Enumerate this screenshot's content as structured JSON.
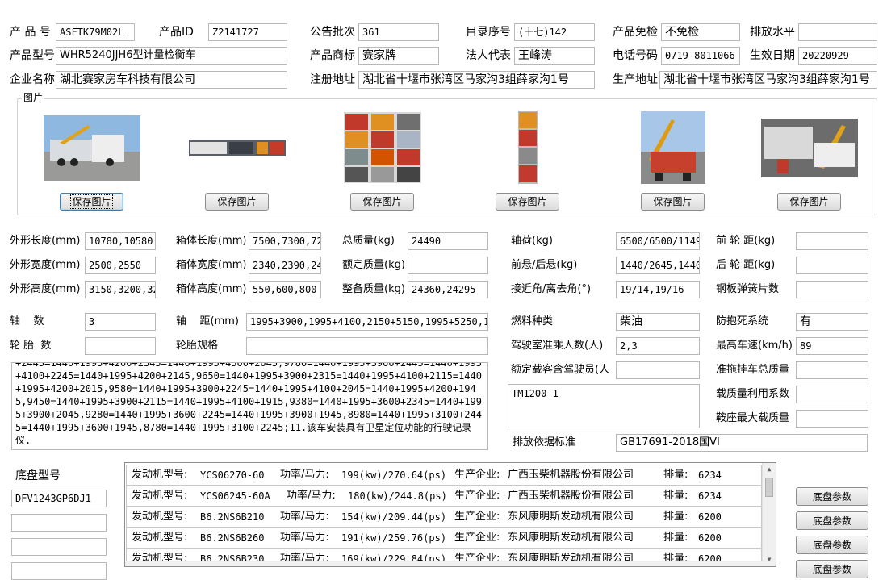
{
  "row1": {
    "product_no_label": "产 品 号",
    "product_no": "ASFTK79M02L",
    "product_id_label": "产品ID",
    "product_id": "Z2141727",
    "batch_label": "公告批次",
    "batch": "361",
    "catalog_label": "目录序号",
    "catalog": "(十七)142",
    "exempt_label": "产品免检",
    "exempt": "不免检",
    "emission_label": "排放水平",
    "emission": ""
  },
  "row2": {
    "model_label": "产品型号",
    "model": "WHR5240JJH6型计量检衡车",
    "brand_label": "产品商标",
    "brand": "赛家牌",
    "legal_label": "法人代表",
    "legal": "王峰涛",
    "phone_label": "电话号码",
    "phone": "0719-8011066",
    "effective_label": "生效日期",
    "effective": "20220929"
  },
  "row3": {
    "company_label": "企业名称",
    "company": "湖北赛家房车科技有限公司",
    "reg_addr_label": "注册地址",
    "reg_addr": "湖北省十堰市张湾区马家沟3组薛家沟1号",
    "prod_addr_label": "生产地址",
    "prod_addr": "湖北省十堰市张湾区马家沟3组薛家沟1号"
  },
  "images": {
    "group_title": "图片",
    "save_label": "保存图片"
  },
  "specs": {
    "ext_len_label": "外形长度(mm)",
    "ext_len": "10780,10580,",
    "ext_wid_label": "外形宽度(mm)",
    "ext_wid": "2500,2550",
    "ext_hgt_label": "外形高度(mm)",
    "ext_hgt": "3150,3200,32",
    "box_len_label": "箱体长度(mm)",
    "box_len": "7500,7300,72",
    "box_wid_label": "箱体宽度(mm)",
    "box_wid": "2340,2390,24",
    "box_hgt_label": "箱体高度(mm)",
    "box_hgt": "550,600,800",
    "gross_label": "总质量(kg)",
    "gross": "24490",
    "rated_label": "额定质量(kg)",
    "rated": "",
    "curb_label": "整备质量(kg)",
    "curb": "24360,24295",
    "axle_load_label": "轴荷(kg)",
    "axle_load": "6500/6500/1149",
    "overhang_label": "前悬/后悬(kg)",
    "overhang": "1440/2645,1440",
    "angle_label": "接近角/离去角(°)",
    "angle": "19/14,19/16",
    "front_track_label": "前 轮 距(kg)",
    "front_track": "",
    "rear_track_label": "后 轮 距(kg)",
    "rear_track": "",
    "spring_label": "钢板弹簧片数",
    "spring": "",
    "axles_label": "轴    数",
    "axles": "3",
    "wheelbase_label": "轴    距(mm)",
    "wheelbase": "1995+3900,1995+4100,2150+5150,1995+5250,19",
    "fuel_label": "燃料种类",
    "fuel": "柴油",
    "abs_label": "防抱死系统",
    "abs": "有",
    "tires_label": "轮 胎  数",
    "tires": "",
    "tire_spec_label": "轮胎规格",
    "tire_spec": "",
    "cab_label": "驾驶室准乘人数(人)",
    "cab": "2,3",
    "max_speed_label": "最高车速(km/h)",
    "max_speed": "89",
    "rated_pass_label": "额定载客含驾驶员(人",
    "rated_pass": "",
    "trailer_label": "准拖挂车总质量",
    "trailer": "",
    "load_util_label": "载质量利用系数",
    "load_util": "",
    "saddle_label": "鞍座最大载质量",
    "saddle": "",
    "emission_std_label": "排放依据标准",
    "emission_std": "GB17691-2018国VI",
    "remarks": "+2445=1440+1995+4200+2345=1440+1995+4500+2045,9780=1440+1995+3900+2445=1440+1995+4100+2245=1440+1995+4200+2145,9650=1440+1995+3900+2315=1440+1995+4100+2115=1440+1995+4200+2015,9580=1440+1995+3900+2245=1440+1995+4100+2045=1440+1995+4200+1945,9450=1440+1995+3900+2115=1440+1995+4100+1915,9380=1440+1995+3600+2345=1440+1995+3900+2045,9280=1440+1995+3600+2245=1440+1995+3900+1945,8980=1440+1995+3100+2445=1440+1995+3600+1945,8780=1440+1995+3100+2245;11.该车安装具有卫星定位功能的行驶记录仪.",
    "other_memo": "TM1200-1"
  },
  "chassis": {
    "label": "底盘型号",
    "models": [
      "DFV1243GP6DJ1",
      "",
      "",
      ""
    ],
    "button_label": "底盘参数"
  },
  "engines": [
    {
      "prefix": "发动机型号:",
      "model": "YCS06270-60",
      "power_label": "功率/马力:",
      "power": "199(kw)/270.64(ps)",
      "maker_label": "生产企业:",
      "maker": "广西玉柴机器股份有限公司",
      "disp_label": "排量:",
      "disp": "6234"
    },
    {
      "prefix": "发动机型号:",
      "model": "YCS06245-60A",
      "power_label": "功率/马力:",
      "power": "180(kw)/244.8(ps)",
      "maker_label": "生产企业:",
      "maker": "广西玉柴机器股份有限公司",
      "disp_label": "排量:",
      "disp": "6234"
    },
    {
      "prefix": "发动机型号:",
      "model": "B6.2NS6B210",
      "power_label": "功率/马力:",
      "power": "154(kw)/209.44(ps)",
      "maker_label": "生产企业:",
      "maker": "东风康明斯发动机有限公司",
      "disp_label": "排量:",
      "disp": "6200"
    },
    {
      "prefix": "发动机型号:",
      "model": "B6.2NS6B260",
      "power_label": "功率/马力:",
      "power": "191(kw)/259.76(ps)",
      "maker_label": "生产企业:",
      "maker": "东风康明斯发动机有限公司",
      "disp_label": "排量:",
      "disp": "6200"
    },
    {
      "prefix": "发动机型号:",
      "model": "B6.2NS6B230",
      "power_label": "功率/马力:",
      "power": "169(kw)/229.84(ps)",
      "maker_label": "生产企业:",
      "maker": "东风康明斯发动机有限公司",
      "disp_label": "排量:",
      "disp": "6200"
    }
  ]
}
